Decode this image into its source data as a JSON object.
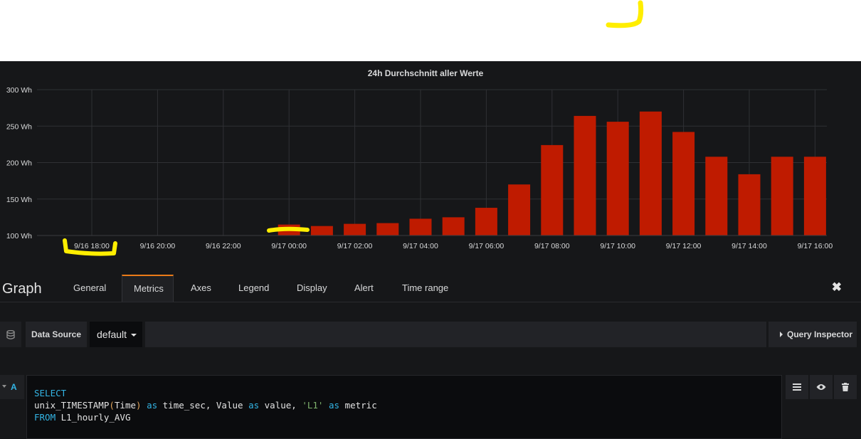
{
  "chart_data": {
    "type": "bar",
    "title": "24h Durchschnitt aller Werte",
    "unit": "Wh",
    "x": [
      "9/16 18:00",
      "9/16 20:00",
      "9/16 22:00",
      "9/17 00:00",
      "9/17 01:00",
      "9/17 02:00",
      "9/17 03:00",
      "9/17 04:00",
      "9/17 05:00",
      "9/17 06:00",
      "9/17 07:00",
      "9/17 08:00",
      "9/17 09:00",
      "9/17 10:00",
      "9/17 11:00",
      "9/17 12:00",
      "9/17 13:00",
      "9/17 14:00",
      "9/17 15:00",
      "9/17 16:00"
    ],
    "bars": [
      {
        "x": "9/17 00:00",
        "value": 115
      },
      {
        "x": "9/17 01:00",
        "value": 113
      },
      {
        "x": "9/17 02:00",
        "value": 116
      },
      {
        "x": "9/17 03:00",
        "value": 117
      },
      {
        "x": "9/17 04:00",
        "value": 123
      },
      {
        "x": "9/17 05:00",
        "value": 125
      },
      {
        "x": "9/17 06:00",
        "value": 138
      },
      {
        "x": "9/17 07:00",
        "value": 170
      },
      {
        "x": "9/17 08:00",
        "value": 224
      },
      {
        "x": "9/17 09:00",
        "value": 264
      },
      {
        "x": "9/17 10:00",
        "value": 256
      },
      {
        "x": "9/17 11:00",
        "value": 270
      },
      {
        "x": "9/17 12:00",
        "value": 242
      },
      {
        "x": "9/17 13:00",
        "value": 208
      },
      {
        "x": "9/17 14:00",
        "value": 184
      },
      {
        "x": "9/17 15:00",
        "value": 208
      },
      {
        "x": "9/17 16:00",
        "value": 208
      }
    ],
    "x_tick_labels": [
      "9/16 18:00",
      "9/16 20:00",
      "9/16 22:00",
      "9/17 00:00",
      "9/17 02:00",
      "9/17 04:00",
      "9/17 06:00",
      "9/17 08:00",
      "9/17 10:00",
      "9/17 12:00",
      "9/17 14:00",
      "9/17 16:00"
    ],
    "y_ticks": [
      100,
      150,
      200,
      250,
      300
    ],
    "y_tick_labels": [
      "100 Wh",
      "150 Wh",
      "200 Wh",
      "250 Wh",
      "300 Wh"
    ],
    "ylim": [
      100,
      300
    ],
    "grid": true,
    "bar_color": "#bf1b00"
  },
  "editor": {
    "title": "Graph",
    "tabs": [
      "General",
      "Metrics",
      "Axes",
      "Legend",
      "Display",
      "Alert",
      "Time range"
    ],
    "active_tab": "Metrics",
    "close_icon": "close-icon"
  },
  "datasource": {
    "label": "Data Source",
    "value": "default",
    "query_inspector": "Query Inspector"
  },
  "query": {
    "ref": "A",
    "lines": [
      "SELECT",
      "unix_TIMESTAMP(Time) as time_sec, Value as value, 'L1' as metric",
      "FROM L1_hourly_AVG"
    ]
  },
  "colors": {
    "accent": "#eb7b18",
    "keyword": "#33b5e5",
    "string": "#7eb26d",
    "highlight_marker": "#ffee00"
  }
}
